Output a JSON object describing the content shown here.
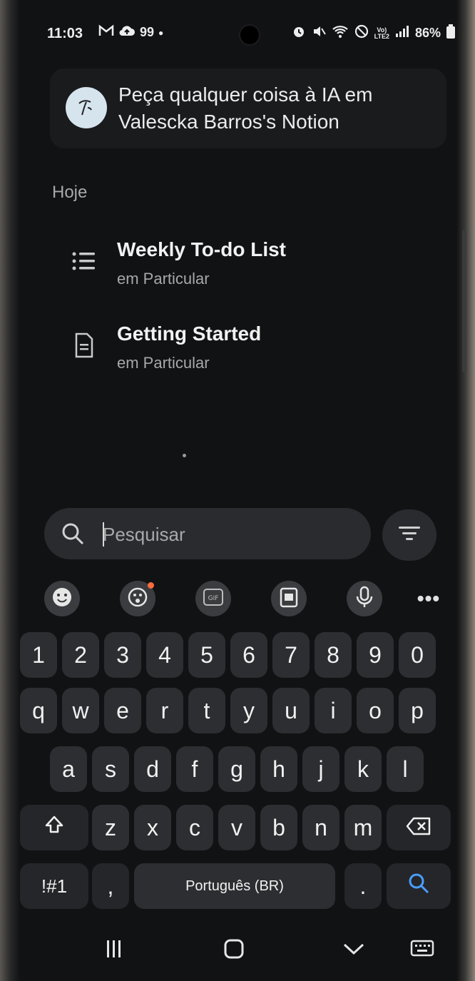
{
  "status_bar": {
    "time": "11:03",
    "left_icons": [
      "gmail-icon",
      "cloud-upload-icon",
      "notification-count"
    ],
    "notif_count": "99",
    "battery": "86%",
    "right_icons": [
      "alarm-icon",
      "mute-icon",
      "wifi-icon",
      "dnd-icon",
      "volte-icon",
      "signal-icon",
      "battery-icon"
    ],
    "volte_label": "Vo))\nLTE2"
  },
  "ai_prompt": {
    "text_line1": "Peça qualquer coisa à IA em",
    "text_line2": "Valescka Barros's Notion"
  },
  "sections": {
    "today_label": "Hoje"
  },
  "recent_items": [
    {
      "title": "Weekly To-do List",
      "subtitle": "em Particular",
      "icon": "list-icon"
    },
    {
      "title": "Getting Started",
      "subtitle": "em Particular",
      "icon": "document-icon"
    }
  ],
  "search": {
    "placeholder": "Pesquisar"
  },
  "keyboard": {
    "row_numbers": [
      "1",
      "2",
      "3",
      "4",
      "5",
      "6",
      "7",
      "8",
      "9",
      "0"
    ],
    "row1": [
      "q",
      "w",
      "e",
      "r",
      "t",
      "y",
      "u",
      "i",
      "o",
      "p"
    ],
    "row2": [
      "a",
      "s",
      "d",
      "f",
      "g",
      "h",
      "j",
      "k",
      "l"
    ],
    "row3": [
      "z",
      "x",
      "c",
      "v",
      "b",
      "n",
      "m"
    ],
    "symbols_label": "!#1",
    "comma": ",",
    "space_label": "Português (BR)",
    "period": "."
  },
  "colors": {
    "background": "#111214",
    "card": "#1a1b1d",
    "key": "#2d2e31",
    "accent_search": "#4a9eff",
    "badge": "#ff6b3d"
  }
}
